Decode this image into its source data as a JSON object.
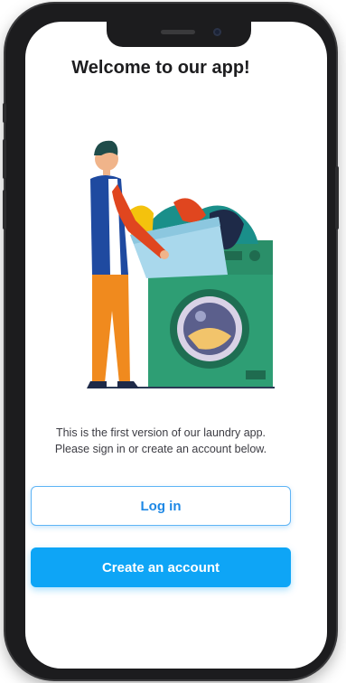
{
  "screen": {
    "title": "Welcome to our app!",
    "description_line1": "This is the first version of our laundry app.",
    "description_line2": "Please sign in or create an account below.",
    "login_label": "Log in",
    "create_account_label": "Create an account"
  },
  "colors": {
    "primary": "#0ea5f6",
    "login_border": "#5fb4f5",
    "washer": "#2e9e74",
    "figure_shirt": "#1f4aa0",
    "figure_pants": "#f08a1e"
  },
  "illustration": "person-loading-washing-machine"
}
